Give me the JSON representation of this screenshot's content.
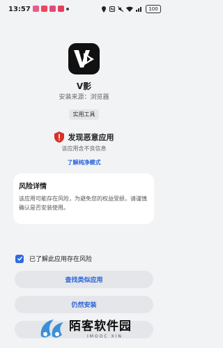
{
  "status_bar": {
    "time": "13:57",
    "battery": "100"
  },
  "app": {
    "name": "V影",
    "source": "安装来源：浏览器",
    "tag": "实用工具"
  },
  "warning": {
    "title": "发现恶意应用",
    "subtitle": "该应用含不良信息",
    "learn_more": "了解纯净模式"
  },
  "risk_card": {
    "title": "风险详情",
    "body": "该应用可能存在风险，为避免您的权益受损，请谨慎确认是否安装使用。"
  },
  "acknowledge": {
    "label": "已了解此应用存在风险",
    "checked": true
  },
  "buttons": {
    "find_similar": "查找类似应用",
    "install_anyway": "仍然安装"
  },
  "watermark": {
    "text": "陌客软件园",
    "sub": "IMOOC XIN"
  },
  "colors": {
    "accent": "#2962d9",
    "warning_red": "#d93025"
  }
}
